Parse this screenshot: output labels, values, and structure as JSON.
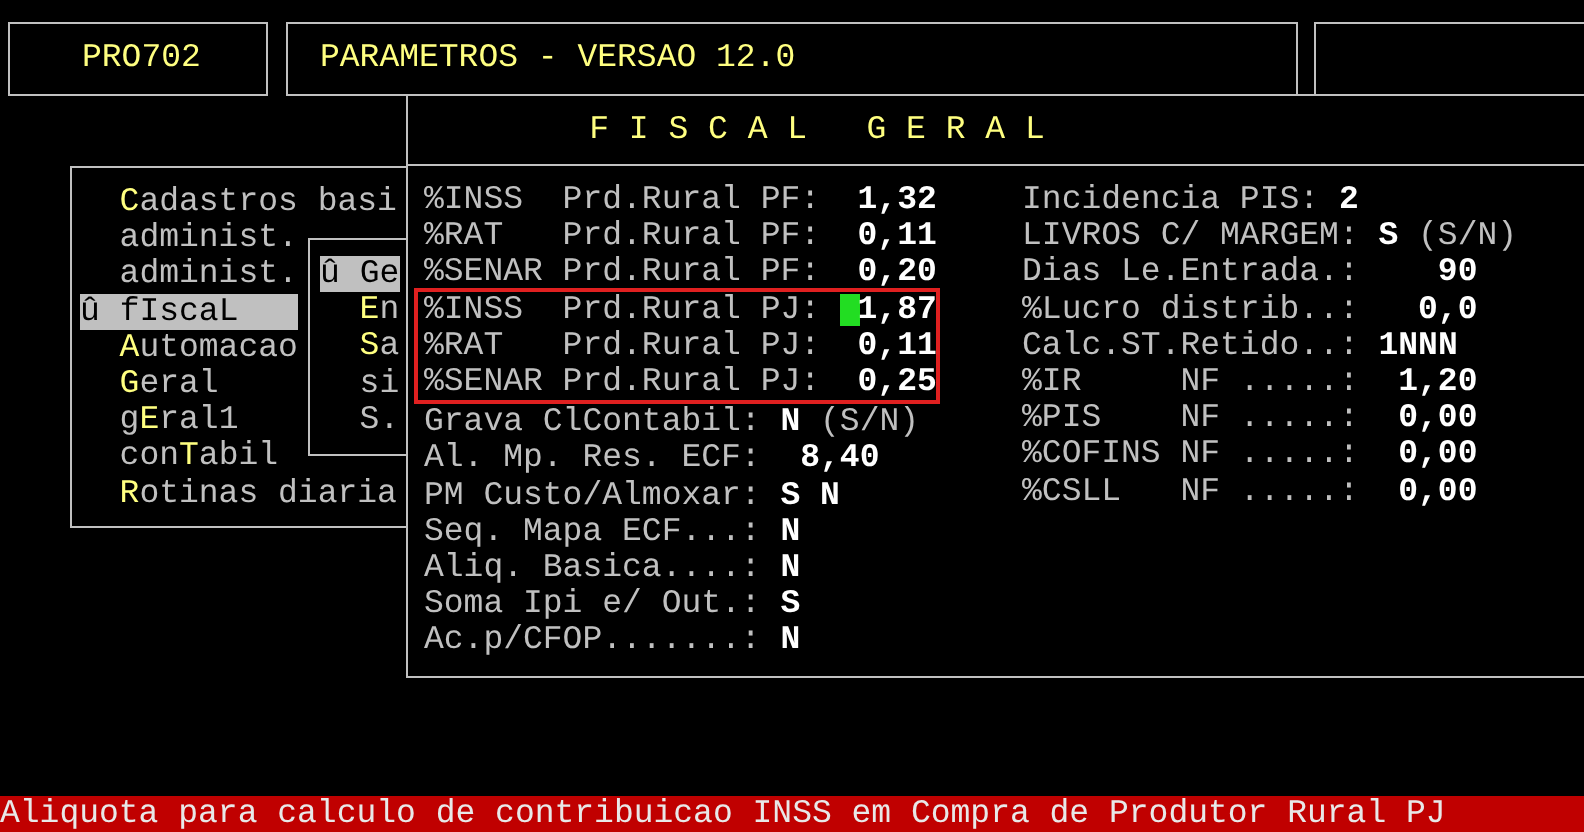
{
  "program_code": "PRO702",
  "title": "PARAMETROS - VERSAO 12.0",
  "main_menu": [
    {
      "key": "C",
      "post": "adastros basi",
      "selected": false
    },
    {
      "pre": "administ.",
      "selected": false
    },
    {
      "pre": "administ.",
      "selected": false
    },
    {
      "marker": "û",
      "pre": "fIscaL",
      "selected": true
    },
    {
      "key": "A",
      "post": "utomacao",
      "selected": false
    },
    {
      "key": "G",
      "post": "eral",
      "selected": false
    },
    {
      "pre": "g",
      "key": "E",
      "post": "ral1",
      "selected": false
    },
    {
      "pre": "con",
      "key": "T",
      "post": "abil",
      "selected": false
    },
    {
      "key": "R",
      "post": "otinas diaria",
      "selected": false
    }
  ],
  "sub_menu": [
    {
      "marker": "û",
      "pre": "Ge",
      "selected": true
    },
    {
      "key": "E",
      "post": "n",
      "selected": false
    },
    {
      "key": "S",
      "post": "a",
      "selected": false
    },
    {
      "pre": "si",
      "selected": false
    },
    {
      "pre": "S.",
      "selected": false
    }
  ],
  "fiscal": {
    "header": "F I S C A L   G E R A L",
    "left_fields": [
      {
        "label": "%INSS  Prd.Rural PF:",
        "value": "1,32",
        "kind": "number",
        "highlighted": false,
        "cursor": false
      },
      {
        "label": "%RAT   Prd.Rural PF:",
        "value": "0,11",
        "kind": "number",
        "highlighted": false,
        "cursor": false
      },
      {
        "label": "%SENAR Prd.Rural PF:",
        "value": "0,20",
        "kind": "number",
        "highlighted": false,
        "cursor": false
      },
      {
        "label": "%INSS  Prd.Rural PJ:",
        "value": "1,87",
        "kind": "number",
        "highlighted": true,
        "cursor": true
      },
      {
        "label": "%RAT   Prd.Rural PJ:",
        "value": "0,11",
        "kind": "number",
        "highlighted": true,
        "cursor": false
      },
      {
        "label": "%SENAR Prd.Rural PJ:",
        "value": "0,25",
        "kind": "number",
        "highlighted": true,
        "cursor": false
      },
      {
        "label": "Grava ClContabil:",
        "value": "N",
        "hint": "(S/N)",
        "kind": "flag",
        "highlighted": false,
        "cursor": false
      },
      {
        "label": "Al. Mp. Res. ECF:",
        "value": "8,40",
        "kind": "number",
        "highlighted": false,
        "cursor": false
      },
      {
        "label": "PM Custo/Almoxar:",
        "value": "S N",
        "kind": "flag",
        "highlighted": false,
        "cursor": false
      },
      {
        "label": "Seq. Mapa ECF...:",
        "value": "N",
        "kind": "flag",
        "highlighted": false,
        "cursor": false
      },
      {
        "label": "Aliq. Basica....:",
        "value": "N",
        "kind": "flag",
        "highlighted": false,
        "cursor": false
      },
      {
        "label": "Soma Ipi e/ Out.:",
        "value": "S",
        "kind": "flag",
        "highlighted": false,
        "cursor": false
      },
      {
        "label": "Ac.p/CFOP.......:",
        "value": "N",
        "kind": "flag",
        "highlighted": false,
        "cursor": false
      }
    ],
    "right_fields": [
      {
        "label": "Incidencia PIS:",
        "value": "2",
        "kind": "flag"
      },
      {
        "label": "LIVROS C/ MARGEM:",
        "value": "S",
        "hint": "(S/N)",
        "kind": "flag"
      },
      {
        "label": "Dias Le.Entrada.:",
        "value": "90",
        "kind": "number"
      },
      {
        "label": "%Lucro distrib..:",
        "value": "0,0",
        "kind": "number"
      },
      {
        "label": "Calc.ST.Retido..:",
        "value": "1NNN",
        "kind": "flag"
      },
      {
        "label": "%IR     NF .....:",
        "value": "1,20",
        "kind": "number"
      },
      {
        "label": "%PIS    NF .....:",
        "value": "0,00",
        "kind": "number"
      },
      {
        "label": "%COFINS NF .....:",
        "value": "0,00",
        "kind": "number"
      },
      {
        "label": "%CSLL   NF .....:",
        "value": "0,00",
        "kind": "number"
      }
    ]
  },
  "status_bar": "Aliquota para calculo de contribuicao INSS em Compra de Produtor Rural PJ"
}
